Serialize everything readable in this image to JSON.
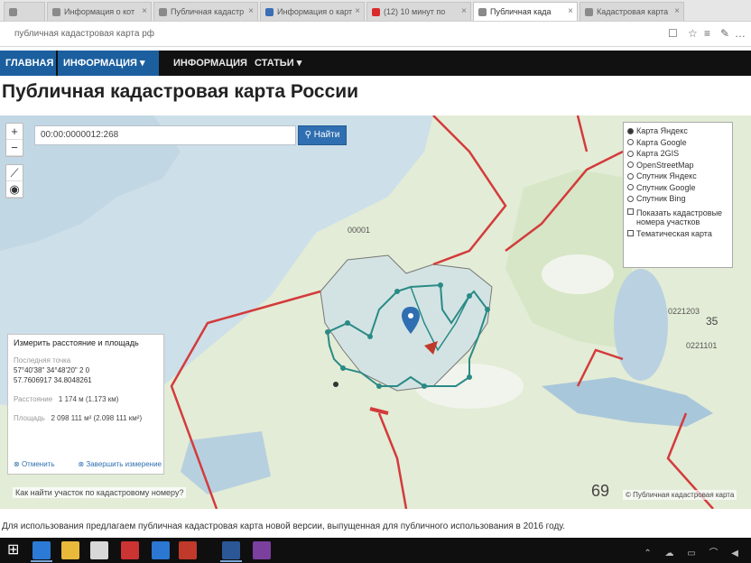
{
  "browser": {
    "tabs": [
      {
        "label": "",
        "icon": "page-icon",
        "active": false
      },
      {
        "label": "Информация о кот",
        "icon": "page-icon",
        "active": false
      },
      {
        "label": "Публичная кадастр",
        "icon": "page-icon",
        "active": false
      },
      {
        "label": "Информация о карт",
        "icon": "page-icon",
        "active": false
      },
      {
        "label": "(12) 10 минут по ",
        "icon": "youtube-icon",
        "active": false
      },
      {
        "label": "Публичная када",
        "icon": "page-icon",
        "active": true
      },
      {
        "label": "Кадастровая карта",
        "icon": "page-icon",
        "active": false
      }
    ],
    "address": "публичная кадастровая карта рф"
  },
  "site_nav": {
    "items": [
      "ГЛАВНАЯ",
      "ИНФОРМАЦИЯ",
      "ИНФОРМАЦИЯ",
      "СТАТЬИ"
    ]
  },
  "page": {
    "title": "Публичная кадастровая карта России",
    "caption": "Для использования предлагаем публичная кадастровая карта новой версии, выпущенная для публичного использования в 2016 году."
  },
  "map": {
    "search_value": "00:00:0000012:268",
    "search_button": "Найти",
    "layers": {
      "base": [
        {
          "label": "Карта Яндекс",
          "selected": true
        },
        {
          "label": "Карта Google",
          "selected": false
        },
        {
          "label": "Карта 2GIS",
          "selected": false
        },
        {
          "label": "OpenStreetMap",
          "selected": false
        },
        {
          "label": "Спутник Яндекс",
          "selected": false
        },
        {
          "label": "Спутник Google",
          "selected": false
        },
        {
          "label": "Спутник Bing",
          "selected": false
        }
      ],
      "overlays": [
        {
          "label": "Показать кадастровые номера участков"
        },
        {
          "label": "Тематическая карта"
        }
      ]
    },
    "coords_panel": {
      "title": "Измерить расстояние и площадь",
      "point_label": "Последняя точка",
      "point_value_1": "57°40'38\" 34°48'20\" 2 0",
      "point_value_2": "57.7606917 34.8048261",
      "distance_label": "Расстояние",
      "distance_value": "1 174 м (1.173 км)",
      "area_label": "Площадь",
      "area_value": "2 098 111 м² (2.098 111 км²)",
      "foot_left": "Отменить",
      "foot_right": "Завершить измерение"
    },
    "question": "Как найти участок по кадастровому номеру?",
    "copyright": "© Публичная кадастровая карта",
    "labels": [
      "69",
      "35",
      "0221203",
      "0221101",
      "00001"
    ]
  },
  "taskbar": {
    "icons": [
      "windows-start",
      "edge-icon",
      "file-explorer-icon",
      "store-icon",
      "calculator-icon",
      "ie-icon",
      "acrobat-icon",
      "word-icon",
      "onenote-icon"
    ]
  }
}
